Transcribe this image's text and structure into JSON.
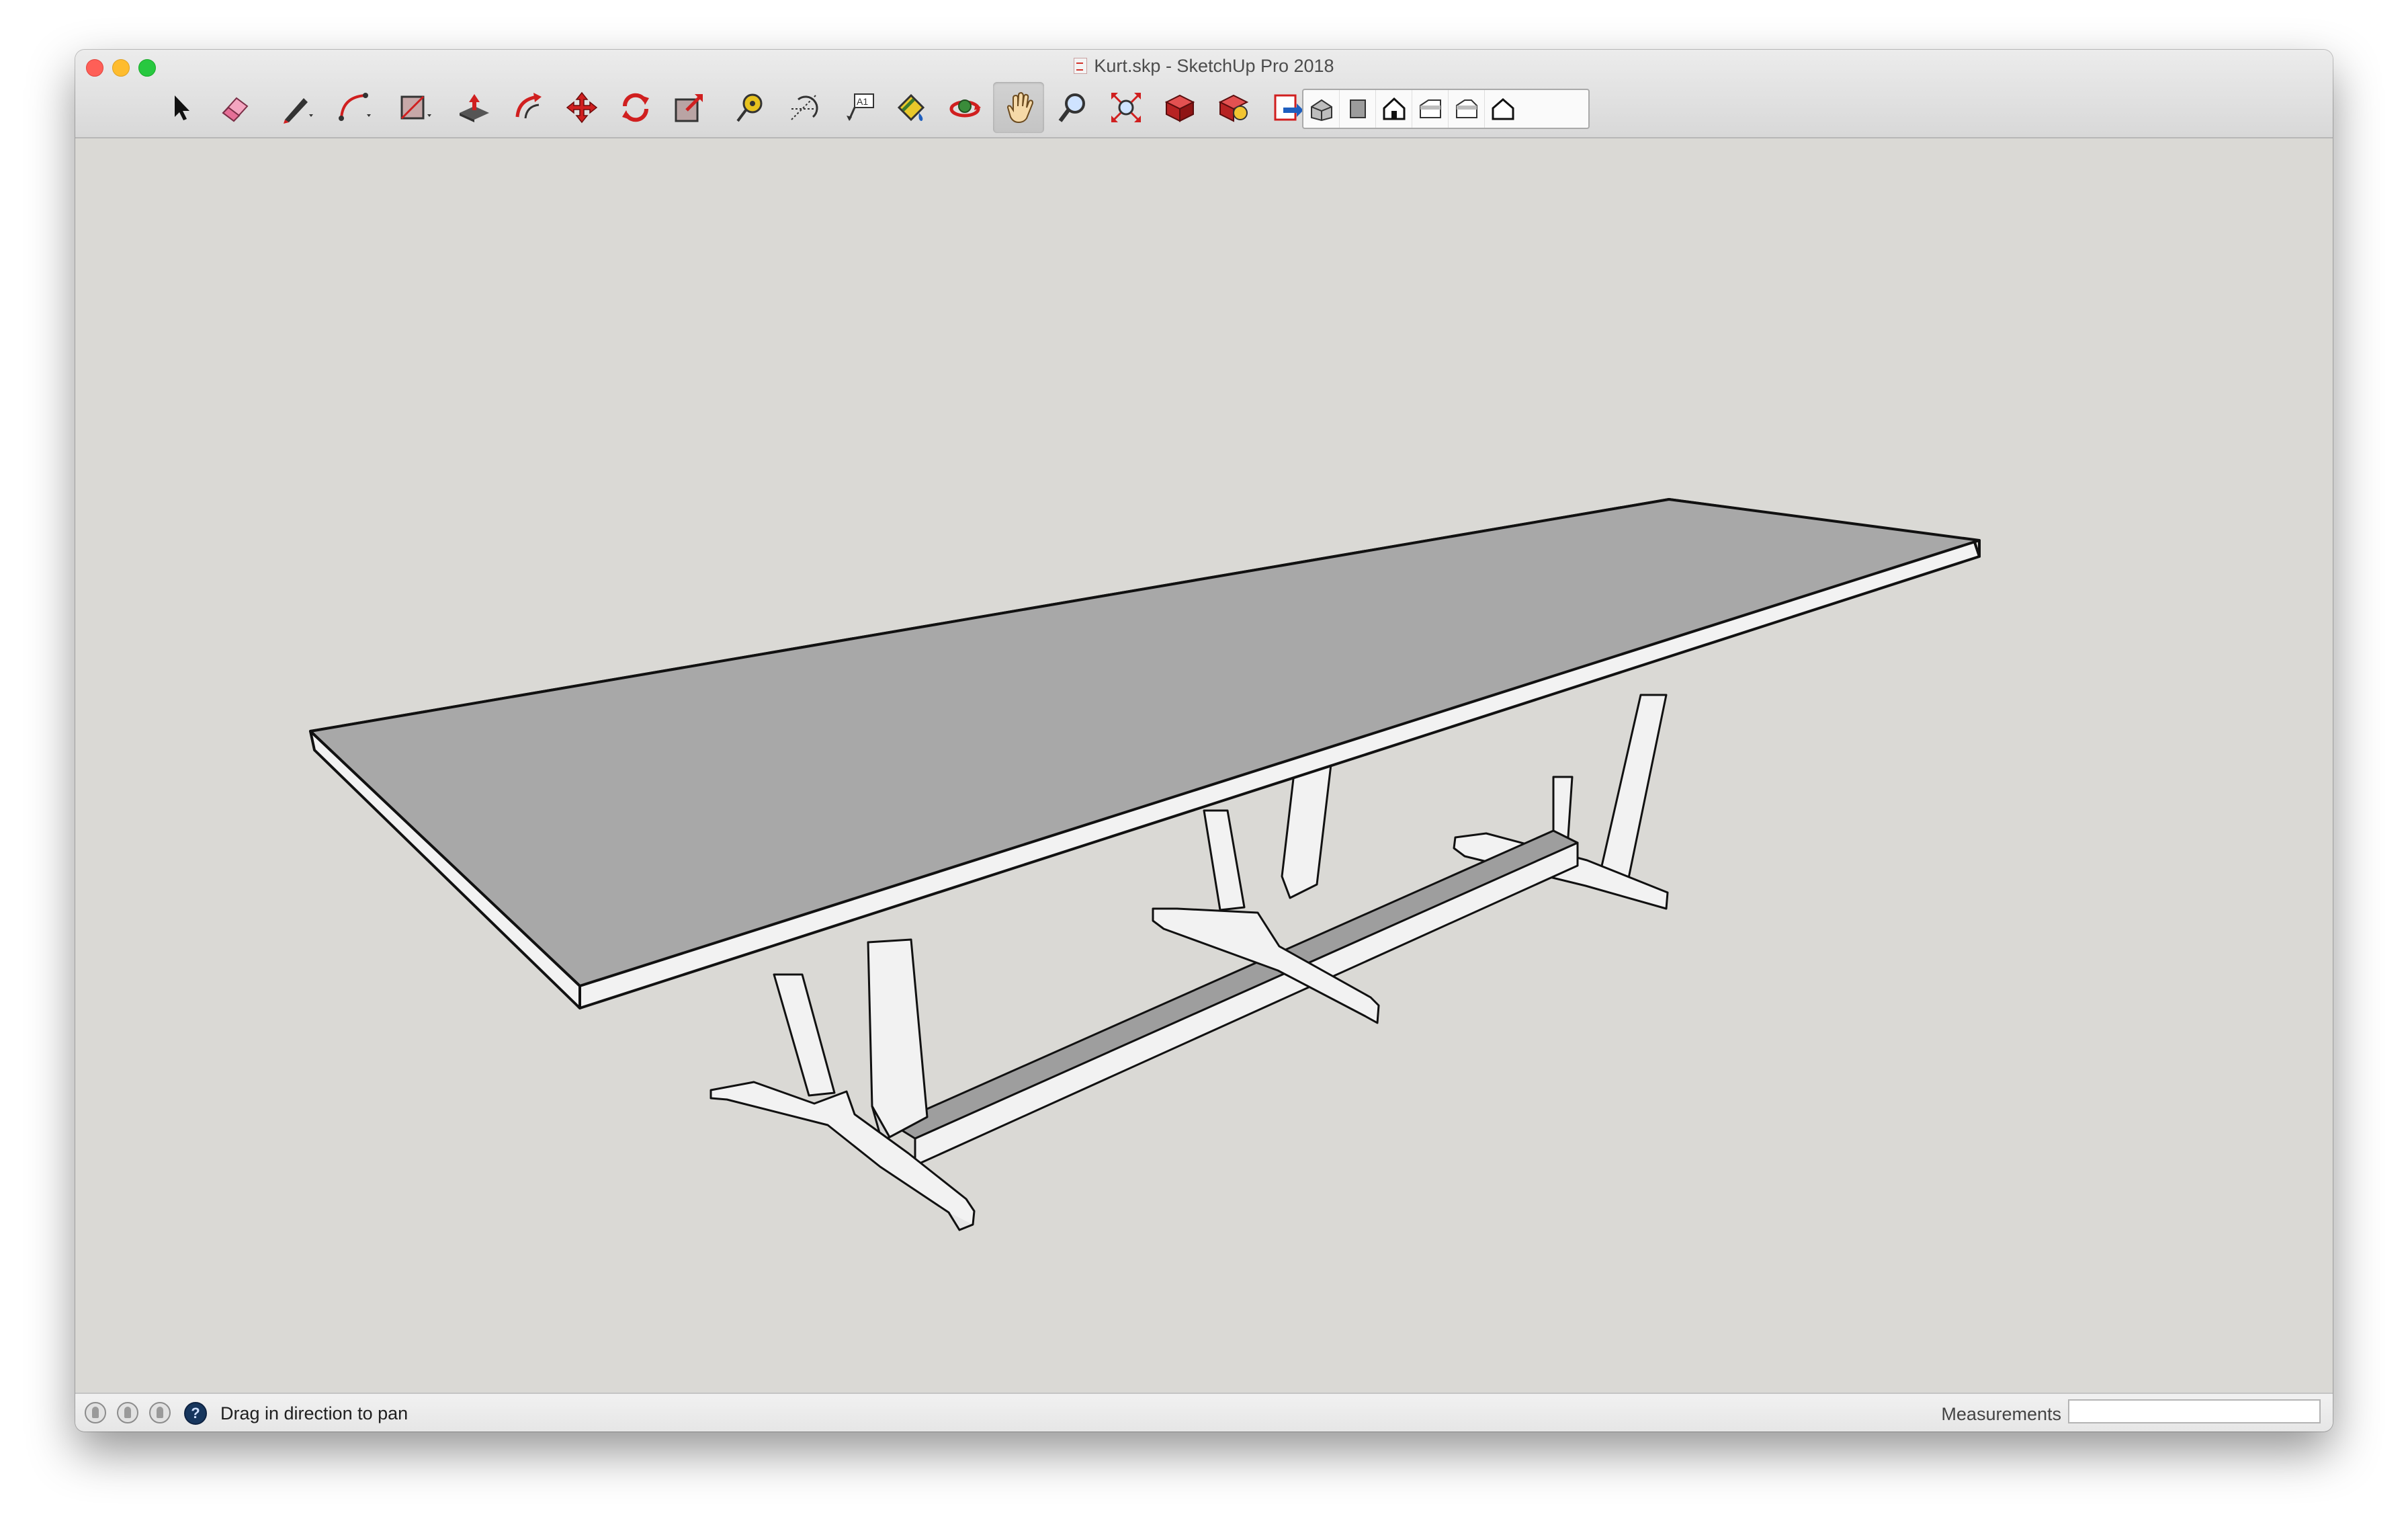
{
  "window": {
    "title": "Kurt.skp - SketchUp Pro 2018"
  },
  "toolbar": {
    "tools": [
      {
        "name": "select-tool-icon"
      },
      {
        "name": "eraser-tool-icon"
      },
      {
        "name": "line-tool-icon"
      },
      {
        "name": "arc-tool-icon"
      },
      {
        "name": "rectangle-tool-icon"
      },
      {
        "name": "push-pull-tool-icon"
      },
      {
        "name": "offset-tool-icon"
      },
      {
        "name": "move-tool-icon"
      },
      {
        "name": "rotate-tool-icon"
      },
      {
        "name": "scale-tool-icon"
      },
      {
        "name": "tape-measure-tool-icon"
      },
      {
        "name": "protractor-tool-icon"
      },
      {
        "name": "text-tool-icon",
        "glyph": "A1"
      },
      {
        "name": "paint-bucket-tool-icon"
      },
      {
        "name": "orbit-tool-icon"
      },
      {
        "name": "pan-tool-icon",
        "active": true
      },
      {
        "name": "zoom-tool-icon"
      },
      {
        "name": "zoom-extents-tool-icon"
      },
      {
        "name": "3d-warehouse-icon"
      },
      {
        "name": "extension-warehouse-icon"
      },
      {
        "name": "send-to-layout-icon"
      },
      {
        "name": "ruby-console-icon"
      }
    ],
    "views": [
      "iso-view-icon",
      "top-view-icon",
      "front-view-icon",
      "right-view-icon",
      "back-view-icon",
      "left-view-icon"
    ]
  },
  "status": {
    "message": "Drag in direction to pan",
    "measurements_label": "Measurements",
    "measurements_value": ""
  },
  "colors": {
    "viewport": "#dad9d5",
    "table_top": "#a8a8a8",
    "table_sides": "#f2f2f2",
    "edges": "#111111",
    "icon_red": "#d01f1f"
  }
}
